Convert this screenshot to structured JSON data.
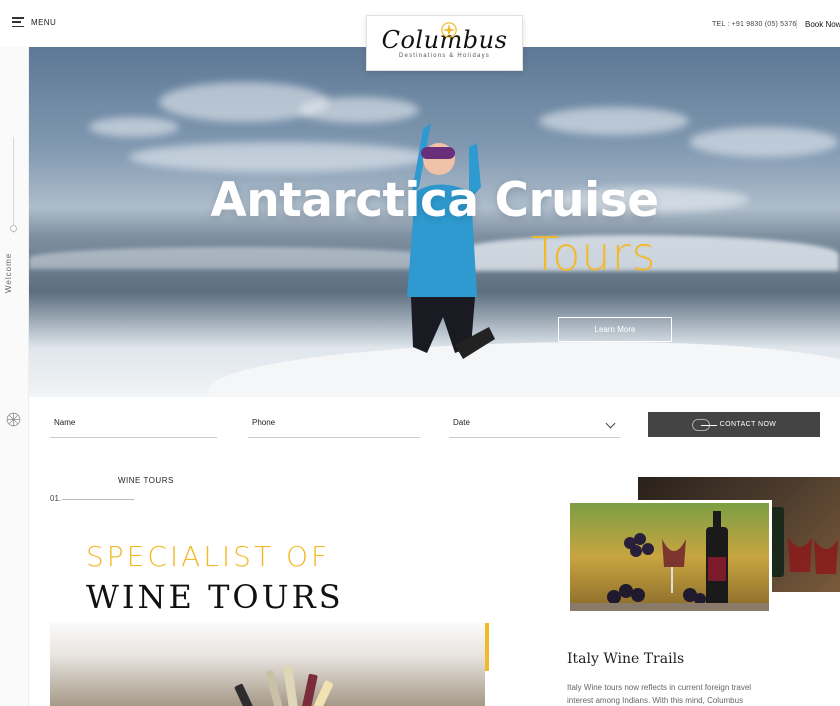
{
  "header": {
    "menu_label": "MENU",
    "logo_text": "Columbus",
    "logo_tagline": "Destinations & Holidays",
    "phone": "TEL : +91 9830 (05) 5376",
    "book_now": "Book Now"
  },
  "rail": {
    "welcome": "Welcome"
  },
  "hero": {
    "title": "Antarctica Cruise",
    "subtitle": "Tours",
    "button": "Learn More"
  },
  "form": {
    "name_label": "Name",
    "phone_label": "Phone",
    "date_label": "Date",
    "contact_button": "CONTACT NOW"
  },
  "section": {
    "tag": "WINE TOURS",
    "number": "01.",
    "heading_line1": "SPECIALIST OF",
    "heading_line2": "WINE TOURS"
  },
  "card": {
    "title": "Italy Wine Trails",
    "text": "Italy Wine tours now reflects in current foreign travel interest among Indians. With this mind, Columbus"
  },
  "colors": {
    "accent": "#f2b928",
    "button_dark": "#444444"
  }
}
